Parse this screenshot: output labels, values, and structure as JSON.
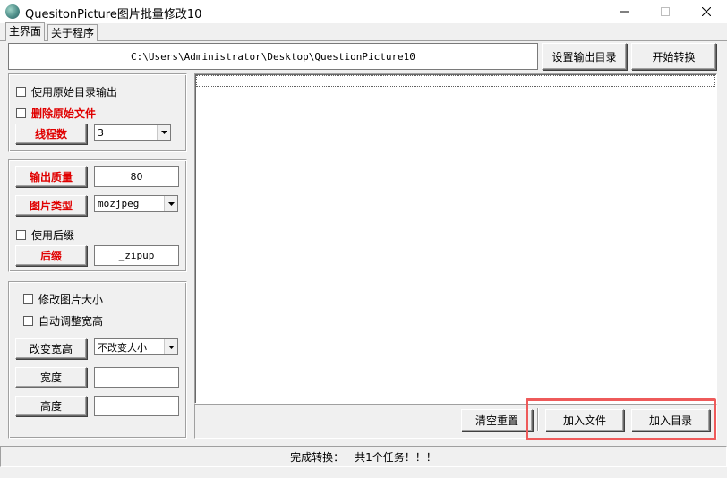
{
  "window": {
    "title": "QuesitonPicture图片批量修改10",
    "controls": {
      "minimize": "minimize",
      "maximize": "maximize",
      "close": "close"
    }
  },
  "tabs": [
    {
      "label": "主界面",
      "active": true
    },
    {
      "label": "关于程序",
      "active": false
    }
  ],
  "toolbar": {
    "path_value": "C:\\Users\\Administrator\\Desktop\\QuestionPicture10",
    "set_output_label": "设置输出目录",
    "start_label": "开始转换"
  },
  "group1": {
    "use_original_dir_label": "使用原始目录输出",
    "use_original_dir_checked": false,
    "delete_original_label": "删除原始文件",
    "delete_original_checked": false,
    "threads_label": "线程数",
    "threads_value": "3"
  },
  "group2": {
    "quality_label": "输出质量",
    "quality_value": "80",
    "type_label": "图片类型",
    "type_value": "mozjpeg",
    "use_suffix_label": "使用后缀",
    "use_suffix_checked": false,
    "suffix_label": "后缀",
    "suffix_value": "_zipup"
  },
  "group3": {
    "resize_label": "修改图片大小",
    "resize_checked": false,
    "auto_adjust_label": "自动调整宽高",
    "auto_adjust_checked": false,
    "change_size_label": "改变宽高",
    "change_size_value": "不改变大小",
    "width_label": "宽度",
    "width_value": "",
    "height_label": "高度",
    "height_value": ""
  },
  "bottom": {
    "clear_label": "清空重置",
    "add_file_label": "加入文件",
    "add_dir_label": "加入目录"
  },
  "status": {
    "text": "完成转换：一共1个任务！！！"
  },
  "colors": {
    "accent_red": "#e00000",
    "highlight_box": "#ee5a5a",
    "window_bg": "#f0f0f0"
  }
}
